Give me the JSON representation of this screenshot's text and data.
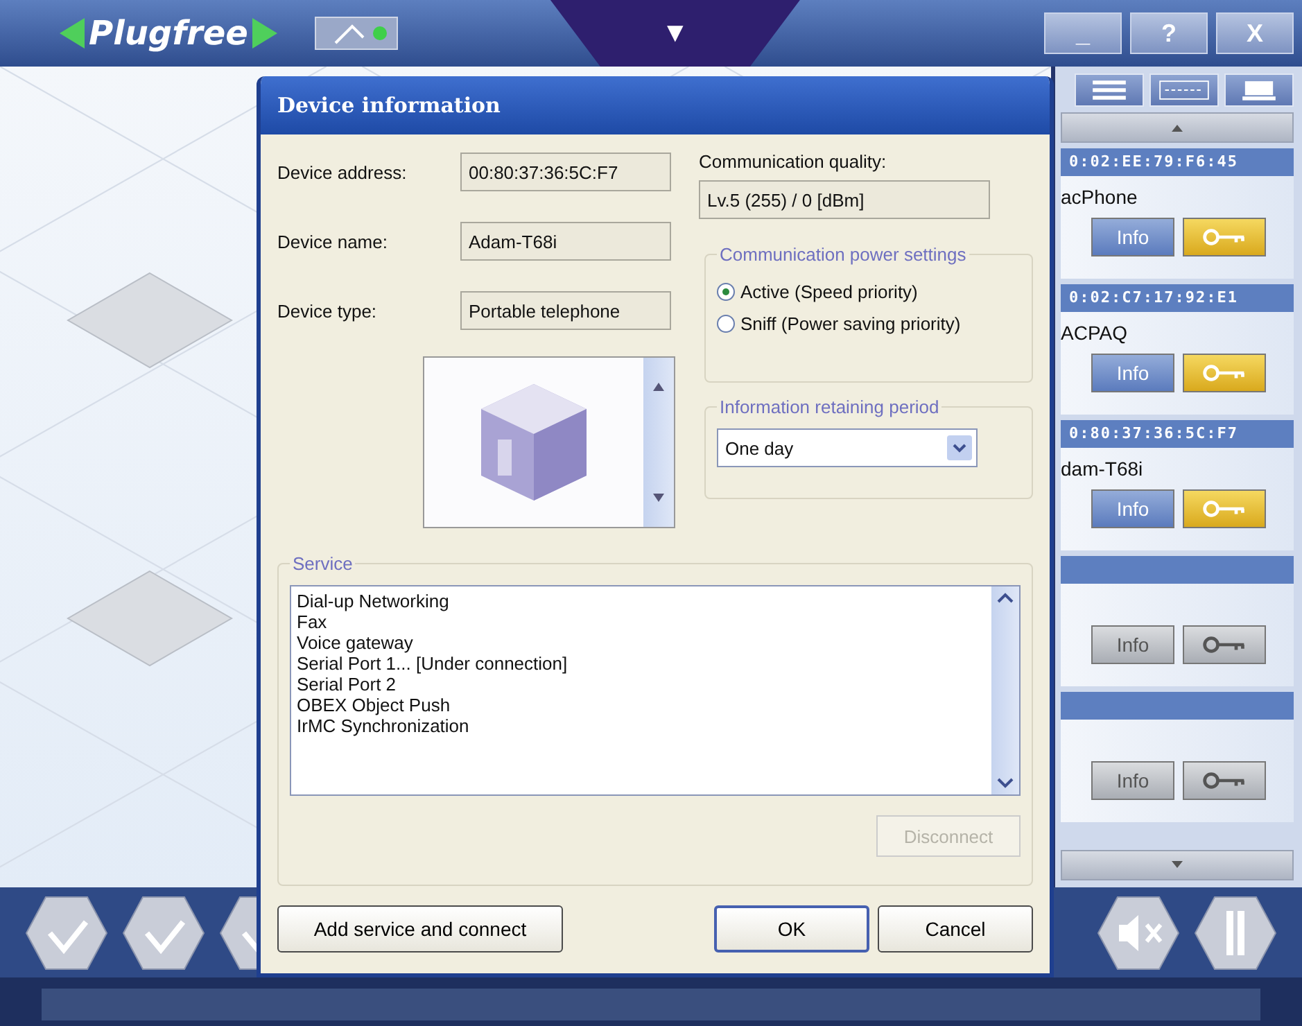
{
  "app": {
    "logo": "Plugfree",
    "menu_glyph": "▼",
    "window_buttons": [
      "_",
      "?",
      "X"
    ]
  },
  "devices": [
    {
      "address": "0:02:EE:79:F6:45",
      "name": "acPhone",
      "info_label": "Info",
      "enabled": true
    },
    {
      "address": "0:02:C7:17:92:E1",
      "name": "ACPAQ",
      "info_label": "Info",
      "enabled": true
    },
    {
      "address": "0:80:37:36:5C:F7",
      "name": "dam-T68i",
      "info_label": "Info",
      "enabled": true
    },
    {
      "info_label": "Info",
      "enabled": false
    },
    {
      "info_label": "Info",
      "enabled": false
    }
  ],
  "dialog": {
    "title": "Device information",
    "fields": [
      {
        "label": "Device address:",
        "value": "00:80:37:36:5C:F7"
      },
      {
        "label": "Device name:",
        "value": "Adam-T68i"
      },
      {
        "label": "Device type:",
        "value": "Portable telephone"
      }
    ],
    "quality": {
      "label": "Communication quality:",
      "value": "Lv.5 (255) / 0 [dBm]"
    },
    "power": {
      "title": "Communication power settings",
      "options": [
        {
          "label": "Active (Speed priority)",
          "selected": true
        },
        {
          "label": "Sniff (Power saving priority)",
          "selected": false
        }
      ]
    },
    "retention": {
      "title": "Information retaining period",
      "value": "One day"
    },
    "service": {
      "title": "Service",
      "items": [
        "Dial-up Networking",
        "Fax",
        "Voice gateway",
        "Serial Port 1... [Under connection]",
        "Serial Port 2",
        "OBEX Object Push",
        "IrMC Synchronization"
      ],
      "disconnect": {
        "label": "Disconnect",
        "disabled": true
      }
    },
    "buttons": [
      {
        "label": "Add service and connect",
        "default": false
      },
      {
        "label": "OK",
        "default": true
      },
      {
        "label": "Cancel",
        "default": false
      }
    ]
  }
}
